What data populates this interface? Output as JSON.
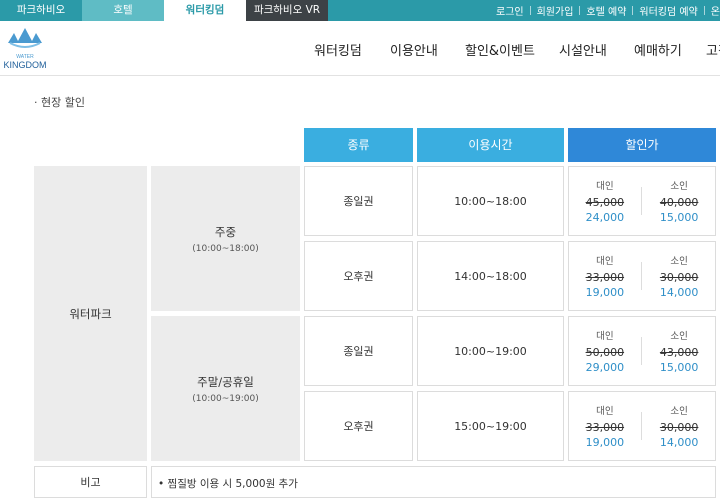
{
  "top_tabs": [
    "파크하비오",
    "호텔",
    "워터킹덤",
    "파크하비오 VR"
  ],
  "top_links": [
    "로그인",
    "회원가입",
    "호텔 예약",
    "워터킹덤 예약",
    "온"
  ],
  "logo": {
    "text_small": "WATER",
    "text_main": "KINGDOM"
  },
  "nav": [
    "워터킹덤",
    "이용안내",
    "할인&이벤트",
    "시설안내",
    "예매하기",
    "고객"
  ],
  "section_title": "·  현장 할인",
  "table": {
    "headers": {
      "type": "종류",
      "time": "이용시간",
      "price": "할인가"
    },
    "category": "워터파크",
    "periods": [
      {
        "name": "주중",
        "hours": "(10:00~18:00)"
      },
      {
        "name": "주말/공휴일",
        "hours": "(10:00~19:00)"
      }
    ],
    "rows": [
      {
        "type": "종일권",
        "time": "10:00~18:00",
        "adult_label": "대인",
        "child_label": "소인",
        "adult_old": "45,000",
        "adult_new": "24,000",
        "child_old": "40,000",
        "child_new": "15,000"
      },
      {
        "type": "오후권",
        "time": "14:00~18:00",
        "adult_label": "대인",
        "child_label": "소인",
        "adult_old": "33,000",
        "adult_new": "19,000",
        "child_old": "30,000",
        "child_new": "14,000"
      },
      {
        "type": "종일권",
        "time": "10:00~19:00",
        "adult_label": "대인",
        "child_label": "소인",
        "adult_old": "50,000",
        "adult_new": "29,000",
        "child_old": "43,000",
        "child_new": "15,000"
      },
      {
        "type": "오후권",
        "time": "15:00~19:00",
        "adult_label": "대인",
        "child_label": "소인",
        "adult_old": "33,000",
        "adult_new": "19,000",
        "child_old": "30,000",
        "child_new": "14,000"
      }
    ],
    "note_label": "비고",
    "note_text": "•  찜질방 이용 시 5,000원 추가"
  },
  "colors": {
    "topbar": "#2b9aa8",
    "header_cell": "#3aaee0",
    "header_cell_price": "#2f88d8",
    "new_price": "#2f8fc8"
  }
}
